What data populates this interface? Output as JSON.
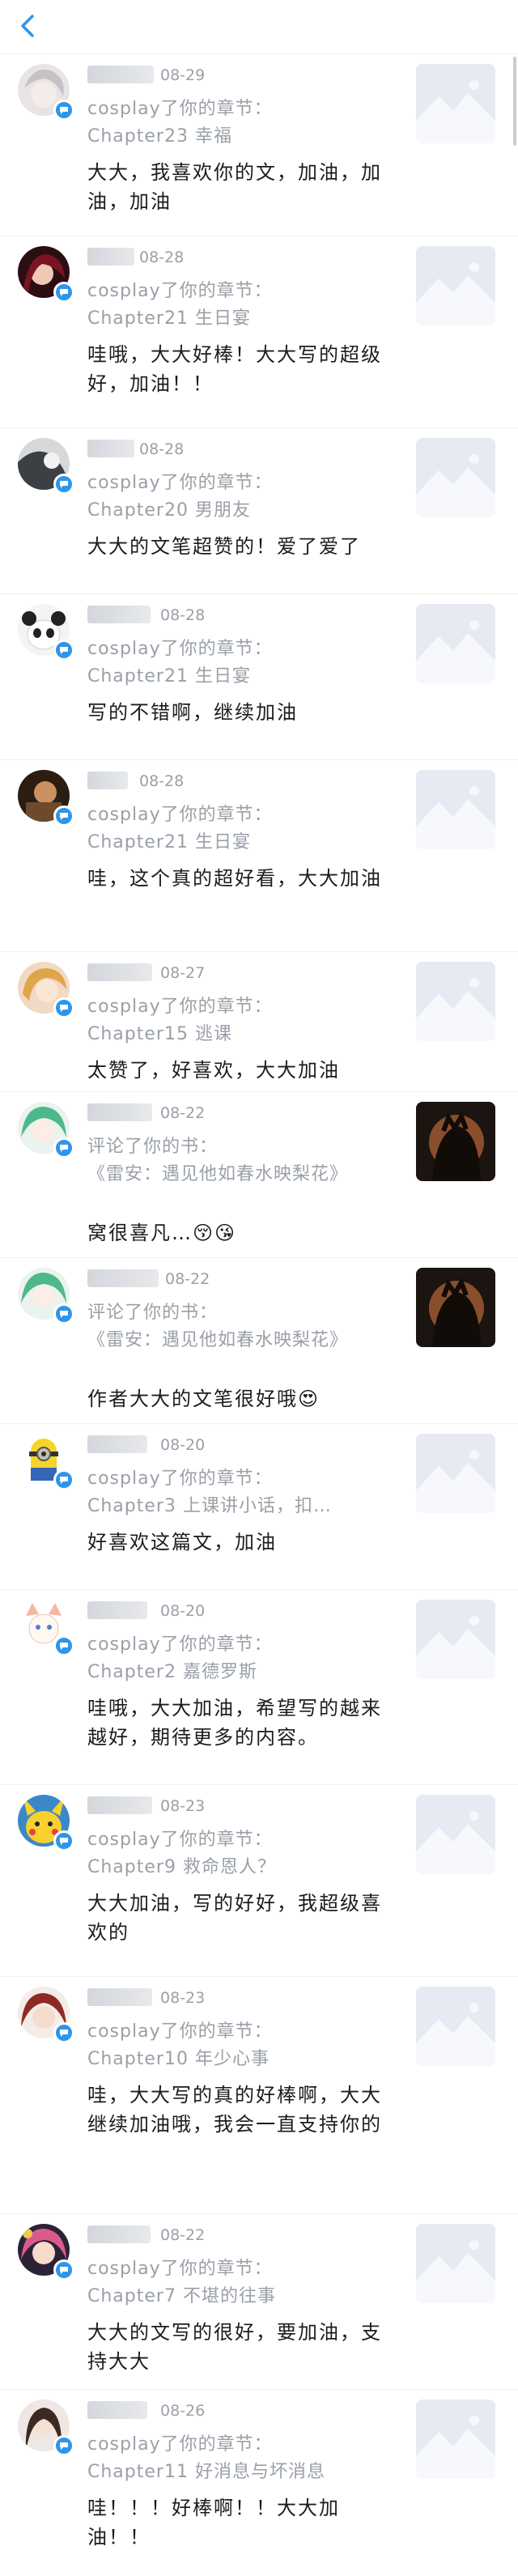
{
  "header": {
    "back_icon": "chevron-left-icon",
    "accent": "#2f95e8"
  },
  "comments": [
    {
      "date": "08-29",
      "action": "cosplay了你的章节：",
      "target": "Chapter23 幸福",
      "content": "大大，我喜欢你的文，加油，加油，加油",
      "avatar": "silver-hair-girl",
      "thumb": "book-cover-placeholder"
    },
    {
      "date": "08-28",
      "action": "cosplay了你的章节：",
      "target": "Chapter21 生日宴",
      "content": "哇哦，大大好棒！大大写的超级好，加油！！",
      "avatar": "red-dark-girl",
      "thumb": "book-cover-placeholder"
    },
    {
      "date": "08-28",
      "action": "cosplay了你的章节：",
      "target": "Chapter20 男朋友",
      "content": "大大的文笔超赞的！爱了爱了",
      "avatar": "gray-sketch",
      "thumb": "book-cover-placeholder"
    },
    {
      "date": "08-28",
      "action": "cosplay了你的章节：",
      "target": "Chapter21 生日宴",
      "content": "写的不错啊，继续加油",
      "avatar": "panda-bw",
      "thumb": "book-cover-placeholder"
    },
    {
      "date": "08-28",
      "action": "cosplay了你的章节：",
      "target": "Chapter21 生日宴",
      "content": "哇，这个真的超好看，大大加油",
      "avatar": "dark-warm-photo",
      "thumb": "book-cover-placeholder"
    },
    {
      "date": "08-27",
      "action": "cosplay了你的章节：",
      "target": "Chapter15 逃课",
      "content": "太赞了，好喜欢，大大加油",
      "avatar": "blonde-girl",
      "thumb": "book-cover-placeholder"
    },
    {
      "date": "08-22",
      "action": "评论了你的书：",
      "target": "《雷安：遇见他如春水映梨花》",
      "content": "窝很喜凡…😚😘",
      "avatar": "green-hair-anime",
      "thumb": "book-cover-photo"
    },
    {
      "date": "08-22",
      "action": "评论了你的书：",
      "target": "《雷安：遇见他如春水映梨花》",
      "content": "作者大大的文笔很好哦😍",
      "avatar": "green-hair-anime",
      "thumb": "book-cover-photo"
    },
    {
      "date": "08-20",
      "action": "cosplay了你的章节：",
      "target": "Chapter3 上课讲小话，扣…",
      "content": "好喜欢这篇文，加油",
      "avatar": "minion",
      "thumb": "book-cover-placeholder"
    },
    {
      "date": "08-20",
      "action": "cosplay了你的章节：",
      "target": "Chapter2 嘉德罗斯",
      "content": "哇哦，大大加油，希望写的越来越好，期待更多的内容。",
      "avatar": "white-cat-girl",
      "thumb": "book-cover-placeholder"
    },
    {
      "date": "08-23",
      "action": "cosplay了你的章节：",
      "target": "Chapter9 救命恩人？",
      "content": "大大加油，写的好好，我超级喜欢的",
      "avatar": "pikachu",
      "thumb": "book-cover-placeholder"
    },
    {
      "date": "08-23",
      "action": "cosplay了你的章节：",
      "target": "Chapter10 年少心事",
      "content": "哇，大大写的真的好棒啊，大大继续加油哦，我会一直支持你的",
      "avatar": "red-hair-anime",
      "thumb": "book-cover-placeholder"
    },
    {
      "date": "08-22",
      "action": "cosplay了你的章节：",
      "target": "Chapter7 不堪的往事",
      "content": "大大的文写的很好，要加油，支持大大",
      "avatar": "colorful-anime",
      "thumb": "book-cover-placeholder"
    },
    {
      "date": "08-26",
      "action": "cosplay了你的章节：",
      "target": "Chapter11 好消息与坏消息",
      "content": "哇！！！好棒啊！！大大加油！！",
      "avatar": "portrait-girl",
      "thumb": "book-cover-placeholder"
    }
  ]
}
